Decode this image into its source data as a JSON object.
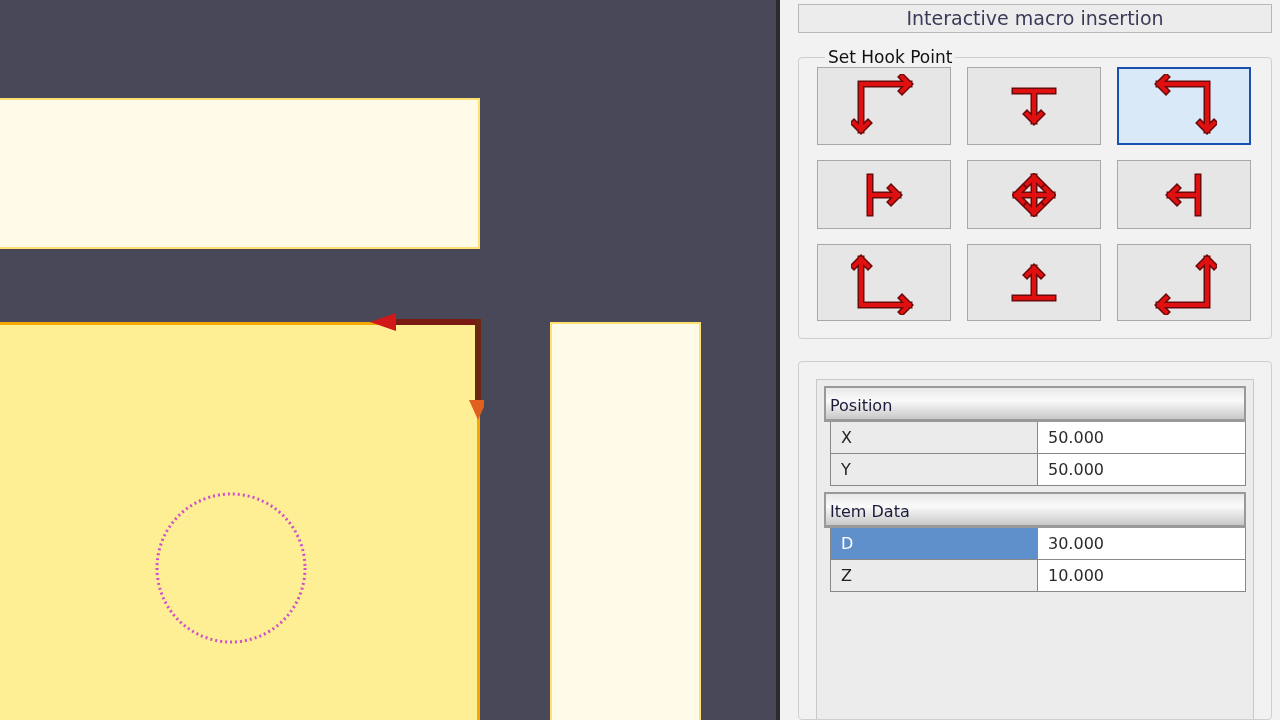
{
  "panel": {
    "title": "Interactive macro insertion"
  },
  "hook_point": {
    "label": "Set Hook Point",
    "buttons": [
      {
        "kind": "top-left",
        "selected": false
      },
      {
        "kind": "top",
        "selected": false
      },
      {
        "kind": "top-right",
        "selected": true
      },
      {
        "kind": "left",
        "selected": false
      },
      {
        "kind": "center",
        "selected": false
      },
      {
        "kind": "right",
        "selected": false
      },
      {
        "kind": "bottom-left",
        "selected": false
      },
      {
        "kind": "bottom",
        "selected": false
      },
      {
        "kind": "bottom-right",
        "selected": false
      }
    ]
  },
  "properties": {
    "sections": [
      {
        "title": "Position",
        "rows": [
          {
            "label": "X",
            "value": "50.000",
            "selected": false
          },
          {
            "label": "Y",
            "value": "50.000",
            "selected": false
          }
        ]
      },
      {
        "title": "Item Data",
        "rows": [
          {
            "label": "D",
            "value": "30.000",
            "selected": true
          },
          {
            "label": "Z",
            "value": "10.000",
            "selected": false
          }
        ]
      }
    ]
  }
}
